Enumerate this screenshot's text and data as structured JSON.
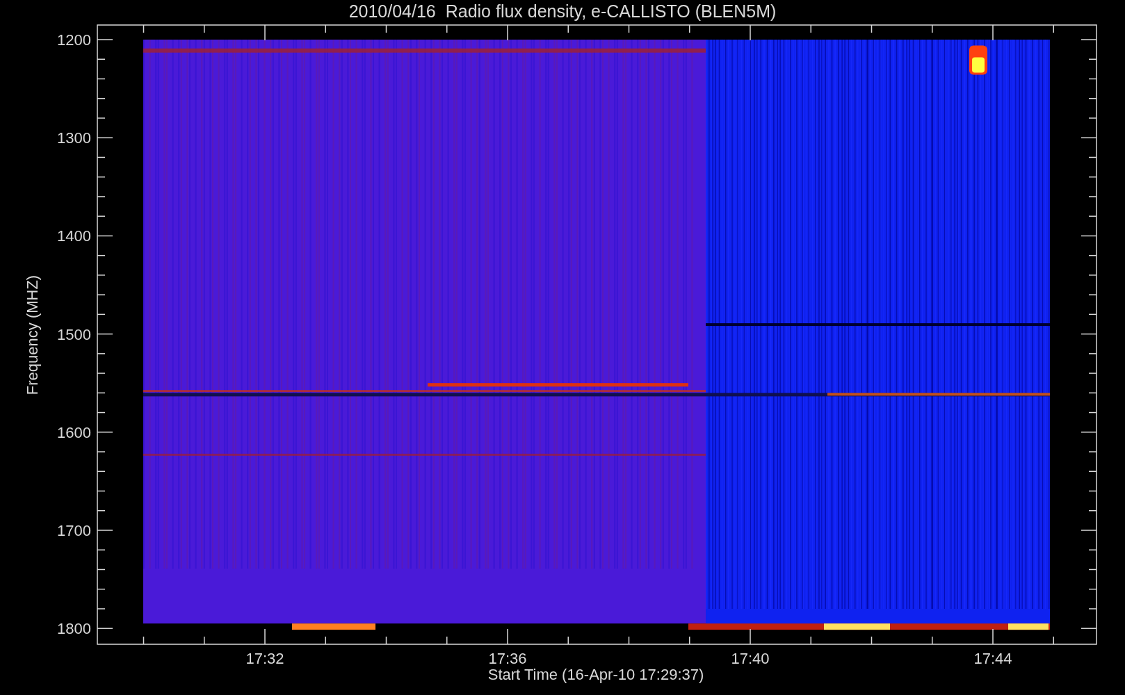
{
  "title": "2010/04/16  Radio flux density, e-CALLISTO (BLEN5M)",
  "y_axis": {
    "label": "Frequency (MHZ)",
    "ticks": [
      "1200",
      "1300",
      "1400",
      "1500",
      "1600",
      "1700",
      "1800"
    ]
  },
  "x_axis": {
    "label": "Start Time (16-Apr-10 17:29:37)",
    "ticks": [
      "17:32",
      "17:36",
      "17:40",
      "17:44"
    ]
  }
}
